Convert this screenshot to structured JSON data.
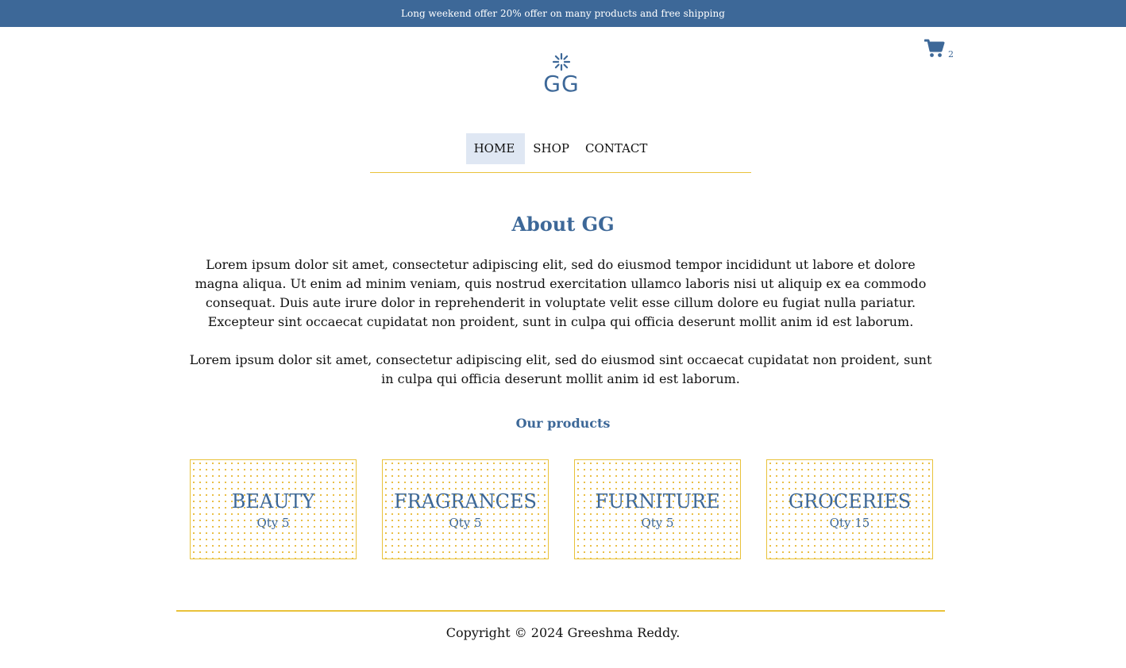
{
  "promo": {
    "text": "Long weekend offer 20% offer on many products and free shipping"
  },
  "cart": {
    "icon": "cart-icon",
    "count": "2"
  },
  "logo": {
    "icon": "flower-icon",
    "text": "GG"
  },
  "nav": {
    "items": [
      {
        "label": "HOME",
        "active": true
      },
      {
        "label": "SHOP",
        "active": false
      },
      {
        "label": "CONTACT",
        "active": false
      }
    ]
  },
  "about": {
    "title": "About GG",
    "paragraphs": [
      "Lorem ipsum dolor sit amet, consectetur adipiscing elit, sed do eiusmod tempor incididunt ut labore et dolore magna aliqua. Ut enim ad minim veniam, quis nostrud exercitation ullamco laboris nisi ut aliquip ex ea commodo consequat. Duis aute irure dolor in reprehenderit in voluptate velit esse cillum dolore eu fugiat nulla pariatur. Excepteur sint occaecat cupidatat non proident, sunt in culpa qui officia deserunt mollit anim id est laborum.",
      "Lorem ipsum dolor sit amet, consectetur adipiscing elit, sed do eiusmod sint occaecat cupidatat non proident, sunt in culpa qui officia deserunt mollit anim id est laborum."
    ]
  },
  "products": {
    "title": "Our products",
    "items": [
      {
        "name": "BEAUTY",
        "qty": "Qty 5"
      },
      {
        "name": "FRAGRANCES",
        "qty": "Qty 5"
      },
      {
        "name": "FURNITURE",
        "qty": "Qty 5"
      },
      {
        "name": "GROCERIES",
        "qty": "Qty 15"
      }
    ]
  },
  "footer": {
    "copyright": "Copyright © 2024 Greeshma Reddy."
  },
  "colors": {
    "brand": "#3d6898",
    "accent": "#e9c23a",
    "nav_active_bg": "#dfe7f3"
  }
}
